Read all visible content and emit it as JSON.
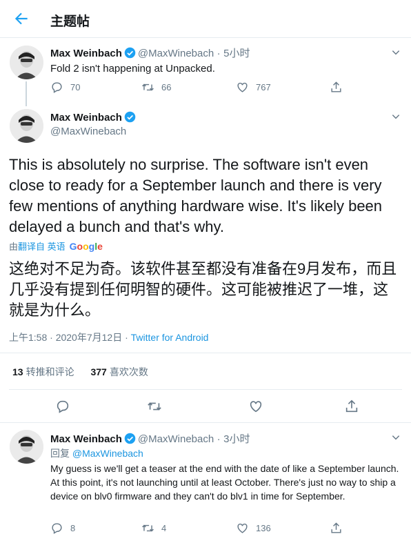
{
  "header": {
    "title": "主题帖"
  },
  "tweet1": {
    "name": "Max Weinbach",
    "handle": "@MaxWinebach",
    "dot": "·",
    "time": "5小时",
    "text": "Fold 2 isn't happening at Unpacked.",
    "replies": "70",
    "retweets": "66",
    "likes": "767"
  },
  "main": {
    "name": "Max Weinbach",
    "handle": "@MaxWinebach",
    "text": "This is absolutely no surprise. The software isn't even close to ready for a September launch and there is very few mentions of anything hardware wise. It's likely been delayed a bunch and that's why.",
    "translate_prefix": "由",
    "translate_link": "翻译自 英语",
    "translate_brand": "Google",
    "translation": "这绝对不足为奇。该软件甚至都没有准备在9月发布，而且几乎没有提到任何明智的硬件。这可能被推迟了一堆，这就是为什么。",
    "timestamp": "上午1:58 · 2020年7月12日 · ",
    "source": "Twitter for Android",
    "retweet_count": "13",
    "retweet_label": "转推和评论",
    "like_count": "377",
    "like_label": "喜欢次数"
  },
  "reply": {
    "name": "Max Weinbach",
    "handle": "@MaxWinebach",
    "dot": "·",
    "time": "3小时",
    "reply_prefix": "回复",
    "reply_to": "@MaxWinebach",
    "text": "My guess is we'll get a teaser at the end with the date of like a September launch. At this point, it's not launching until at least October. There's just no way to ship a device on blv0 firmware and they can't do blv1 in time for September.",
    "replies": "8",
    "retweets": "4",
    "likes": "136"
  },
  "colors": {
    "accent": "#1da1f2",
    "muted": "#657786",
    "border": "#e6ecf0"
  },
  "icons": [
    "back-arrow-icon",
    "verified-icon",
    "chevron-down-icon",
    "reply-icon",
    "retweet-icon",
    "like-icon",
    "share-icon"
  ]
}
